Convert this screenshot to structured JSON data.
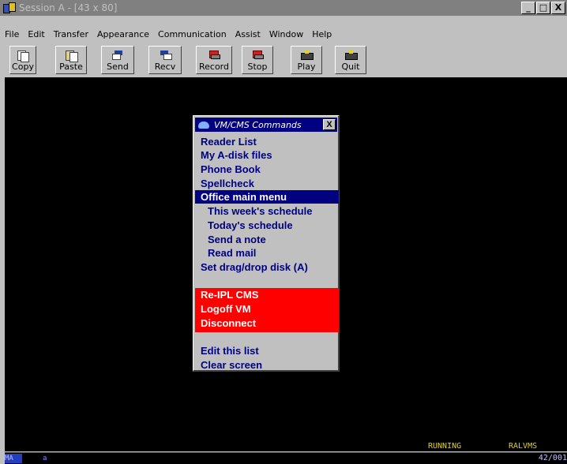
{
  "window": {
    "title": "Session A - [43 x 80]",
    "controls": [
      "_",
      "□",
      "X"
    ]
  },
  "menubar": [
    "File",
    "Edit",
    "Transfer",
    "Appearance",
    "Communication",
    "Assist",
    "Window",
    "Help"
  ],
  "toolbar": {
    "copy": "Copy",
    "paste": "Paste",
    "send": "Send",
    "recv": "Recv",
    "record": "Record",
    "stop": "Stop",
    "play": "Play",
    "quit": "Quit"
  },
  "popup": {
    "title": "VM/CMS Commands",
    "close": "X",
    "items": [
      "Reader List",
      "My A-disk files",
      "Phone Book",
      "Spellcheck",
      "Office main menu",
      "This week's schedule",
      "Today's schedule",
      "Send a note",
      "Read mail",
      "Set drag/drop disk (A)",
      "Re-IPL CMS",
      "Logoff VM",
      "Disconnect",
      "Edit this list",
      "Clear screen"
    ],
    "selected_index": 4
  },
  "terminal": {
    "status": "RUNNING",
    "system": "RALVMS",
    "oia_mode": "MA",
    "oia_a": "a",
    "cursor_pos": "42/001"
  },
  "colors": {
    "titlebar_inactive": "#808080",
    "popup_title": "#000080",
    "popup_text": "#000080",
    "danger": "#ff0000",
    "status_text": "#e0d020"
  }
}
